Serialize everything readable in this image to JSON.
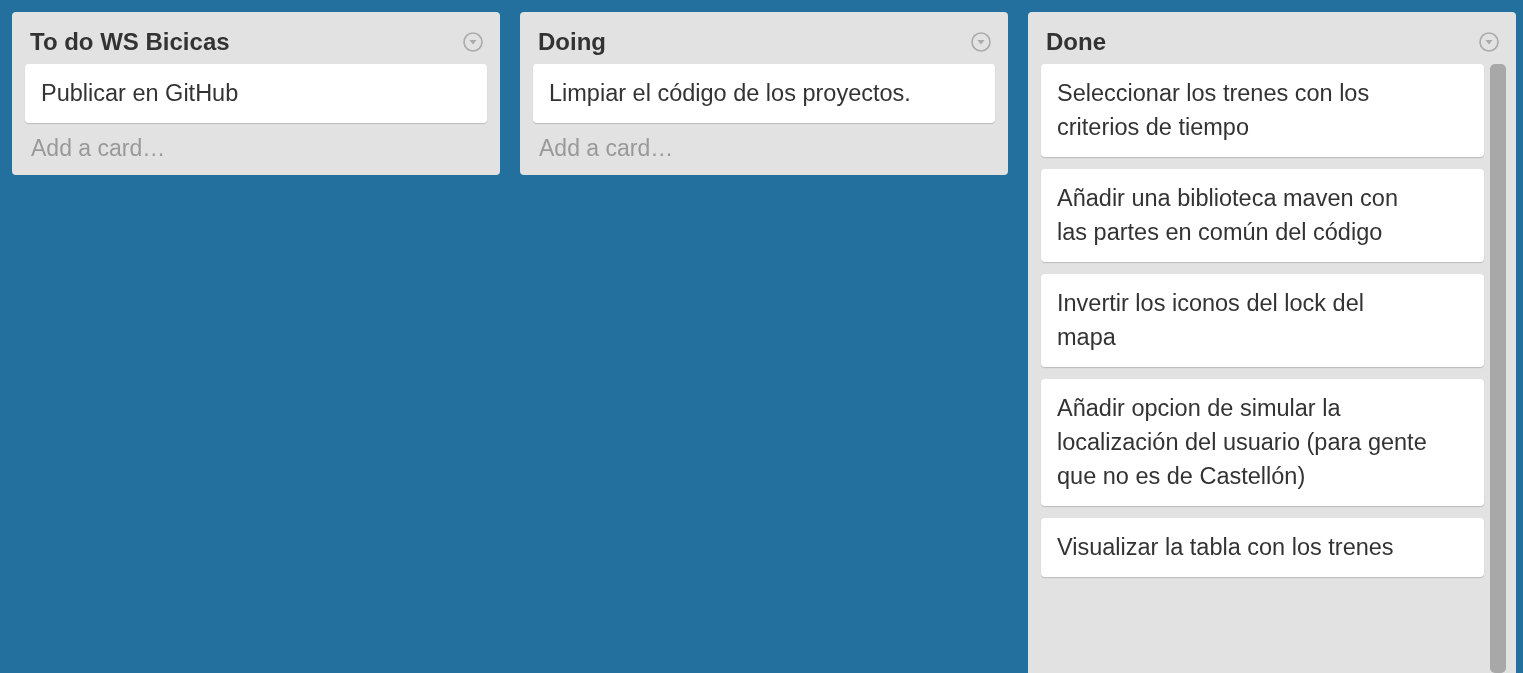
{
  "lists": [
    {
      "title": "To do WS Bicicas",
      "cards": [
        "Publicar en GitHub"
      ],
      "add_card": "Add a card…",
      "scrollable": false
    },
    {
      "title": "Doing",
      "cards": [
        "Limpiar el código de los proyectos."
      ],
      "add_card": "Add a card…",
      "scrollable": false
    },
    {
      "title": "Done",
      "cards": [
        "Seleccionar los trenes con los criterios de tiempo",
        "Añadir una biblioteca maven con las partes en común del código",
        "Invertir los iconos del lock del mapa",
        "Añadir opcion de simular la localización del usuario (para gente que no es de Castellón)",
        "Visualizar la tabla con los trenes"
      ],
      "scrollable": true
    }
  ]
}
